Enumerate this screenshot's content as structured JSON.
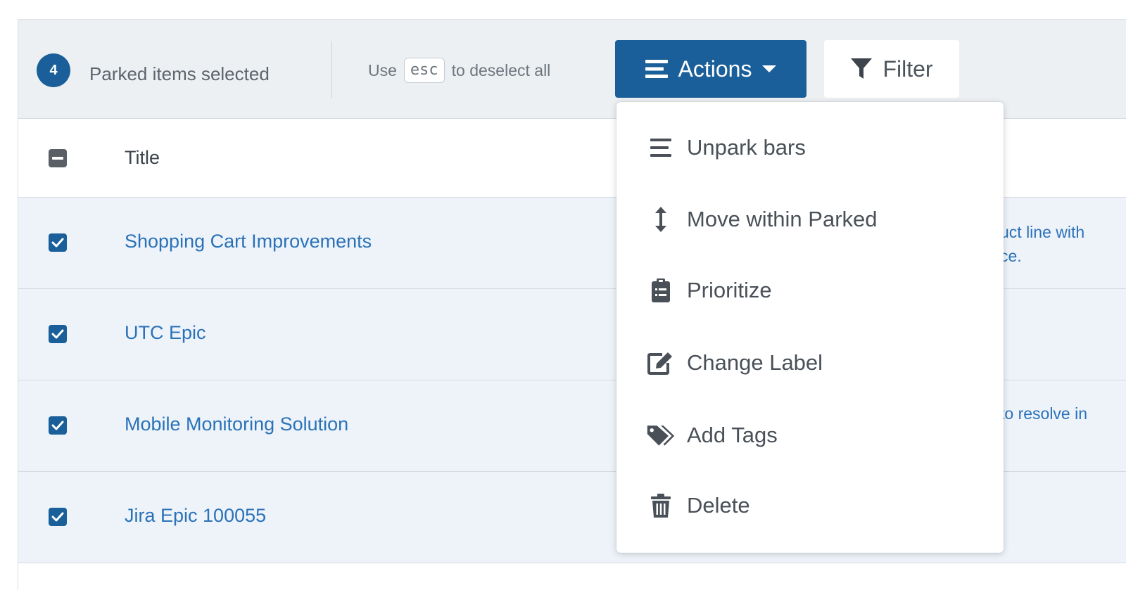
{
  "toolbar": {
    "selected_count": "4",
    "selected_label": "Parked items selected",
    "hint_prefix": "Use",
    "hint_key": "esc",
    "hint_suffix": "to deselect all",
    "actions_label": "Actions",
    "filter_label": "Filter"
  },
  "table": {
    "title_header": "Title",
    "rows": [
      {
        "title": "Shopping Cart Improvements",
        "desc_line1": "uct line with",
        "desc_line2": "ce."
      },
      {
        "title": "UTC Epic",
        "desc_line1": "",
        "desc_line2": ""
      },
      {
        "title": "Mobile Monitoring Solution",
        "desc_line1": "to resolve in",
        "desc_line2": ""
      },
      {
        "title": "Jira Epic 100055",
        "desc_line1": "",
        "desc_line2": ""
      }
    ]
  },
  "actions_menu": {
    "items": [
      {
        "label": "Unpark bars",
        "icon": "list-icon"
      },
      {
        "label": "Move within Parked",
        "icon": "vertical-arrows-icon"
      },
      {
        "label": "Prioritize",
        "icon": "clipboard-icon"
      },
      {
        "label": "Change Label",
        "icon": "edit-icon"
      },
      {
        "label": "Add Tags",
        "icon": "tags-icon"
      },
      {
        "label": "Delete",
        "icon": "trash-icon"
      }
    ]
  },
  "colors": {
    "primary": "#1a5f99",
    "link": "#2a72b8",
    "toolbar_bg": "#edf0f3",
    "selected_row_bg": "#eef3fa"
  }
}
